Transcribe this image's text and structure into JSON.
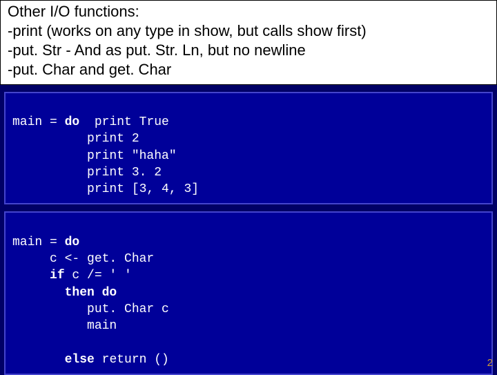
{
  "heading": {
    "l1": "Other I/O functions:",
    "l2": "-print (works on any type in show, but calls show first)",
    "l3": "-put. Str - And as put. Str. Ln, but no newline",
    "l4": "-put. Char and get. Char"
  },
  "code1": {
    "l1a": "main = ",
    "l1b": "do",
    "l1c": "  print True",
    "l2": "          print 2",
    "l3": "          print \"haha\"",
    "l4": "          print 3. 2",
    "l5": "          print [3, 4, 3]"
  },
  "code2": {
    "l1a": "main = ",
    "l1b": "do",
    "l2": "     c <- get. Char",
    "l3a": "     ",
    "l3b": "if",
    "l3c": " c /= ' '",
    "l4a": "       ",
    "l4b": "then do",
    "l5": "          put. Char c",
    "l6": "          main",
    "blank": " ",
    "l7a": "       ",
    "l7b": "else",
    "l7c": " return ()"
  },
  "page_number": "2"
}
